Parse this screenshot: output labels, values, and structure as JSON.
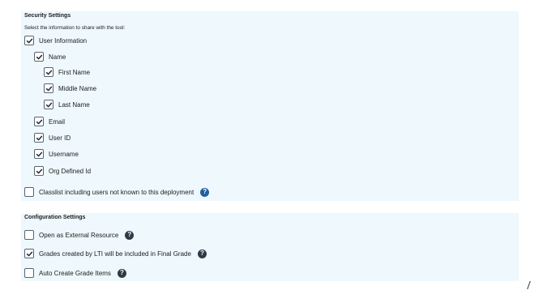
{
  "security": {
    "heading": "Security Settings",
    "description": "Select the information to share with the tool:",
    "items": [
      {
        "label": "User Information",
        "checked": true
      },
      {
        "label": "Name",
        "checked": true
      },
      {
        "label": "First Name",
        "checked": true
      },
      {
        "label": "Middle Name",
        "checked": true
      },
      {
        "label": "Last Name",
        "checked": true
      },
      {
        "label": "Email",
        "checked": true
      },
      {
        "label": "User ID",
        "checked": true
      },
      {
        "label": "Username",
        "checked": true
      },
      {
        "label": "Org Defined Id",
        "checked": true
      },
      {
        "label": "Classlist including users not known to this deployment",
        "checked": false,
        "help_icon": "help-icon"
      }
    ]
  },
  "config": {
    "heading": "Configuration Settings",
    "items": [
      {
        "label": "Open as External Resource",
        "checked": false,
        "help_icon": "help-icon"
      },
      {
        "label": "Grades created by LTI will be included in Final Grade",
        "checked": true,
        "help_icon": "help-icon"
      },
      {
        "label": "Auto Create Grade Items",
        "checked": false,
        "help_icon": "help-icon"
      }
    ]
  },
  "colors": {
    "panel_bg": "#eef8fd",
    "checkbox_border": "#5b6470",
    "help_icon_blue": "#1f5fa0",
    "help_icon_dark": "#2f3a46"
  }
}
